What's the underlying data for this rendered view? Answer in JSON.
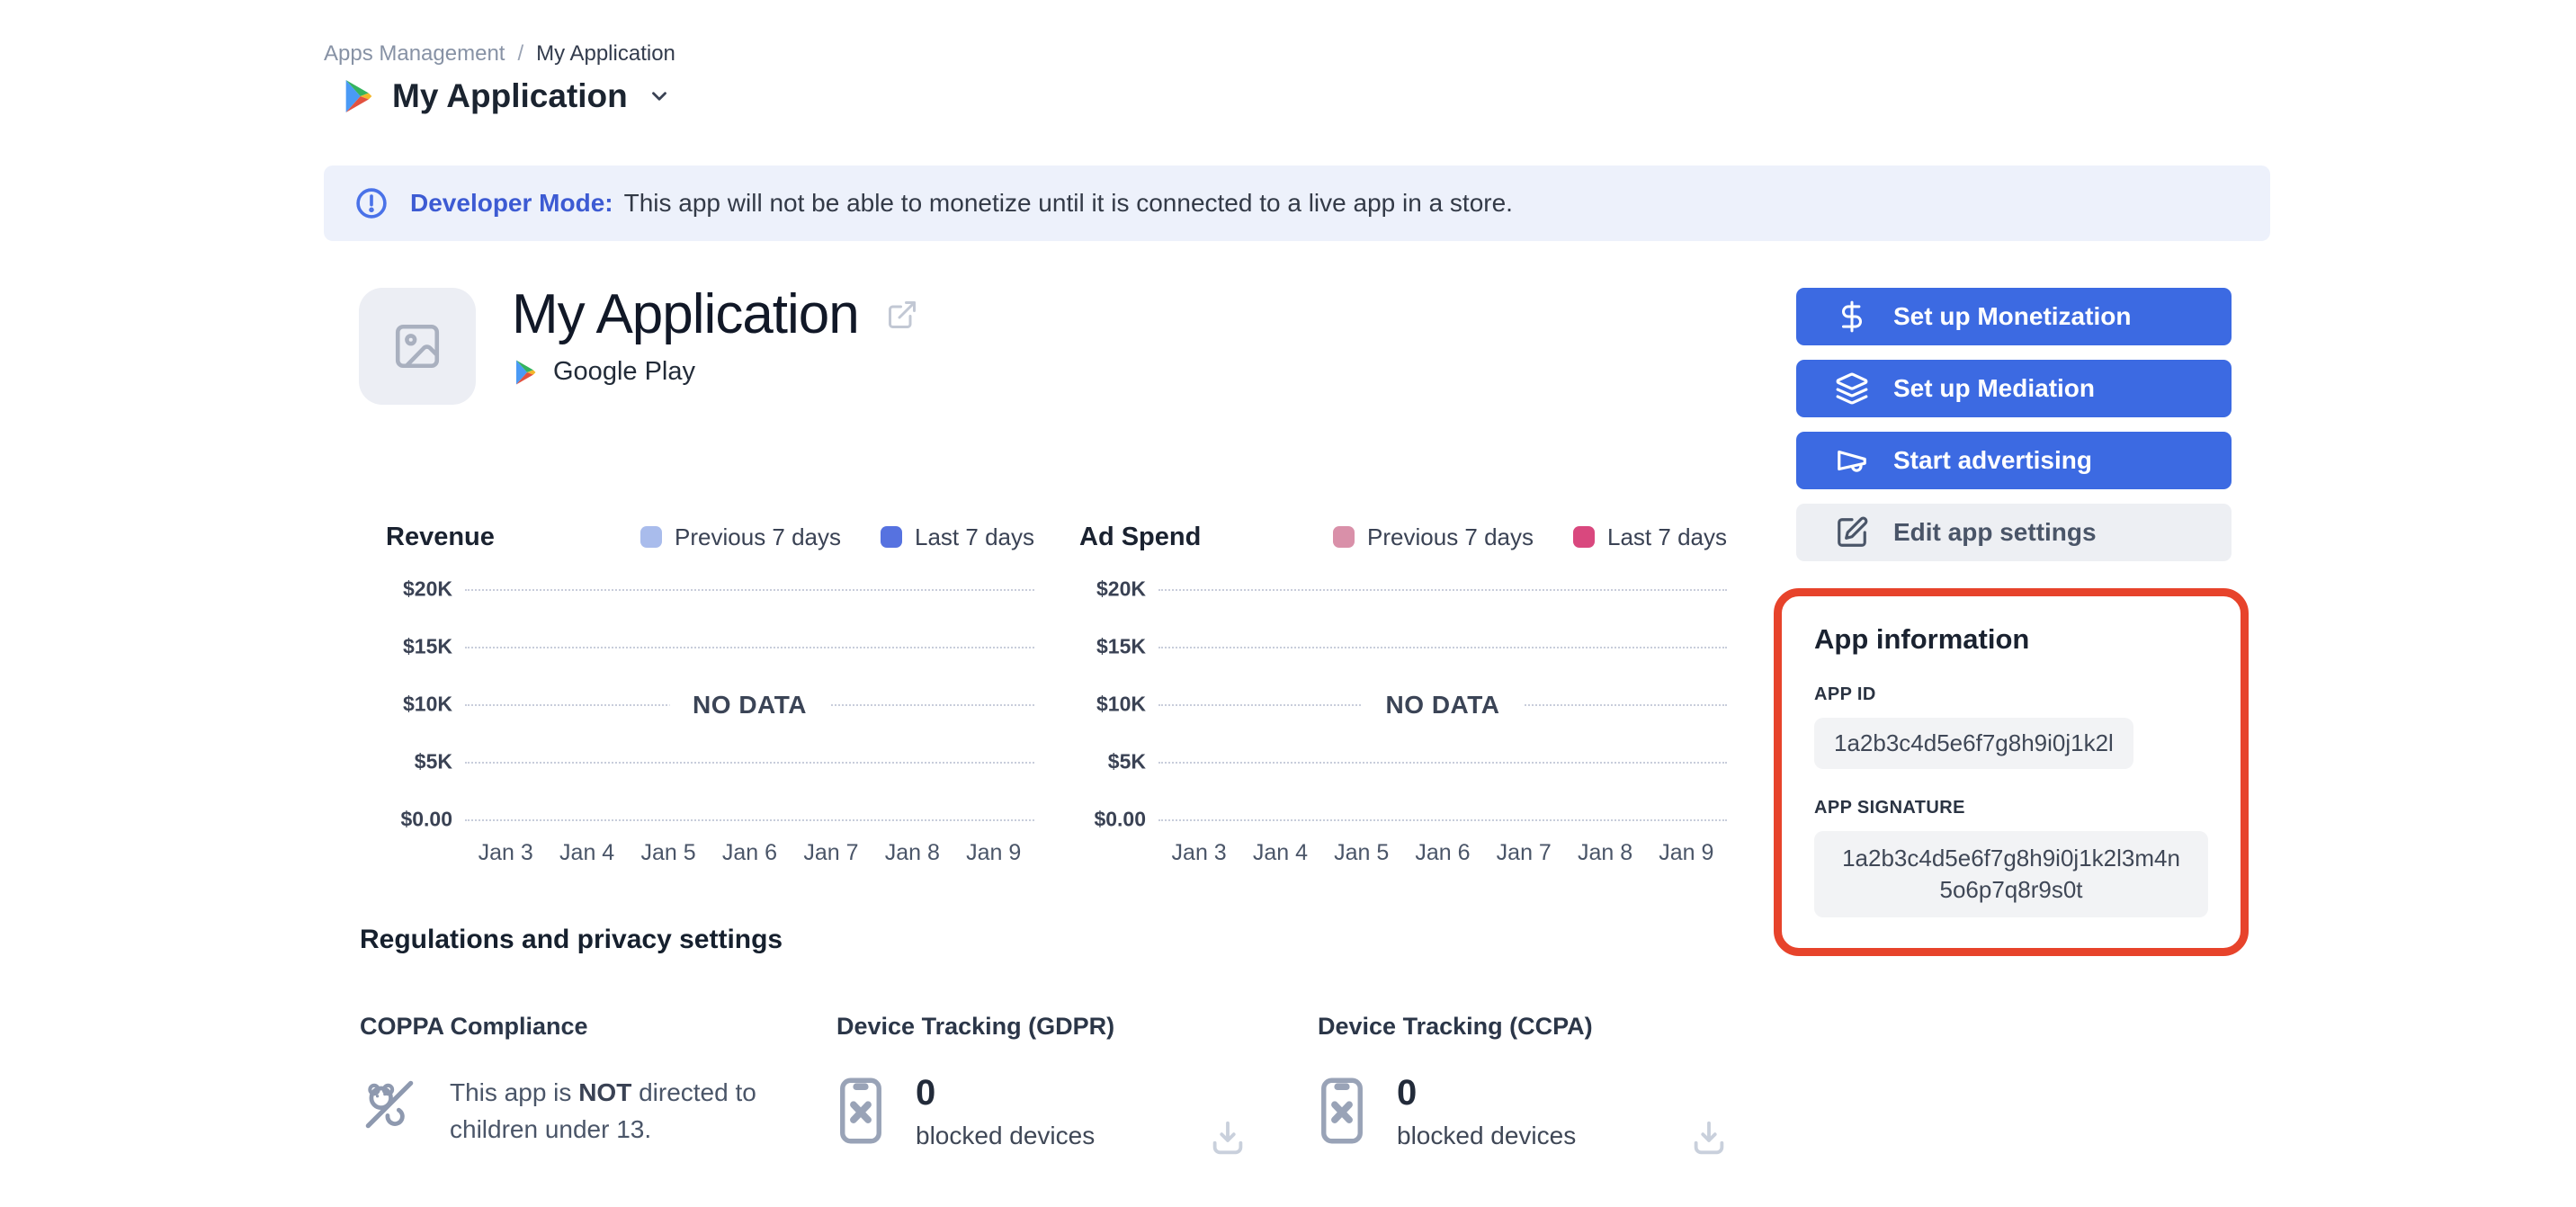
{
  "breadcrumb": {
    "parent": "Apps Management",
    "separator": "/",
    "current": "My Application"
  },
  "header": {
    "title": "My Application"
  },
  "banner": {
    "title": "Developer Mode:",
    "message": "This app will not be able to monetize until it is connected to a live app in a store."
  },
  "app": {
    "name": "My Application",
    "platform": "Google Play"
  },
  "actions": {
    "monetization": {
      "label": "Set up Monetization"
    },
    "mediation": {
      "label": "Set up Mediation"
    },
    "advertising": {
      "label": "Start advertising"
    },
    "edit": {
      "label": "Edit app settings"
    }
  },
  "legend": {
    "previous": "Previous 7 days",
    "last": "Last 7 days"
  },
  "charts": {
    "revenue": {
      "title": "Revenue",
      "no_data": "NO DATA"
    },
    "ad_spend": {
      "title": "Ad Spend",
      "no_data": "NO DATA"
    },
    "y_ticks": [
      "$20K",
      "$15K",
      "$10K",
      "$5K",
      "$0.00"
    ],
    "x_ticks": [
      "Jan 3",
      "Jan 4",
      "Jan 5",
      "Jan 6",
      "Jan 7",
      "Jan 8",
      "Jan 9"
    ]
  },
  "chart_data": [
    {
      "type": "line",
      "title": "Revenue",
      "x": [
        "Jan 3",
        "Jan 4",
        "Jan 5",
        "Jan 6",
        "Jan 7",
        "Jan 8",
        "Jan 9"
      ],
      "series": [
        {
          "name": "Previous 7 days",
          "values": []
        },
        {
          "name": "Last 7 days",
          "values": []
        }
      ],
      "ylim": [
        0,
        20000
      ],
      "y_tick_labels": [
        "$0.00",
        "$5K",
        "$10K",
        "$15K",
        "$20K"
      ],
      "grid": "dotted horizontal",
      "legend_position": "top-right",
      "annotation": "NO DATA"
    },
    {
      "type": "line",
      "title": "Ad Spend",
      "x": [
        "Jan 3",
        "Jan 4",
        "Jan 5",
        "Jan 6",
        "Jan 7",
        "Jan 8",
        "Jan 9"
      ],
      "series": [
        {
          "name": "Previous 7 days",
          "values": []
        },
        {
          "name": "Last 7 days",
          "values": []
        }
      ],
      "ylim": [
        0,
        20000
      ],
      "y_tick_labels": [
        "$0.00",
        "$5K",
        "$10K",
        "$15K",
        "$20K"
      ],
      "grid": "dotted horizontal",
      "legend_position": "top-right",
      "annotation": "NO DATA"
    }
  ],
  "app_info": {
    "title": "App information",
    "app_id_label": "APP ID",
    "app_id": "1a2b3c4d5e6f7g8h9i0j1k2l",
    "app_signature_label": "APP SIGNATURE",
    "app_signature": "1a2b3c4d5e6f7g8h9i0j1k2l3m4n5o6p7q8r9s0t"
  },
  "regulations": {
    "title": "Regulations and privacy settings",
    "coppa": {
      "title": "COPPA Compliance",
      "text_pre": "This app is",
      "text_bold": "NOT",
      "text_post": "directed to children under 13."
    },
    "gdpr": {
      "title": "Device Tracking (GDPR)",
      "count": "0",
      "label": "blocked devices"
    },
    "ccpa": {
      "title": "Device Tracking (CCPA)",
      "count": "0",
      "label": "blocked devices"
    }
  },
  "colors": {
    "primary_button": "#3c6ae2",
    "banner_bg": "#edf1fb",
    "banner_accent": "#3d5bd3",
    "annotation_red": "#e7432b",
    "revenue_previous": "#a9bcec",
    "revenue_last": "#5672e0",
    "adspend_previous": "#d990a9",
    "adspend_last": "#d9487e"
  }
}
